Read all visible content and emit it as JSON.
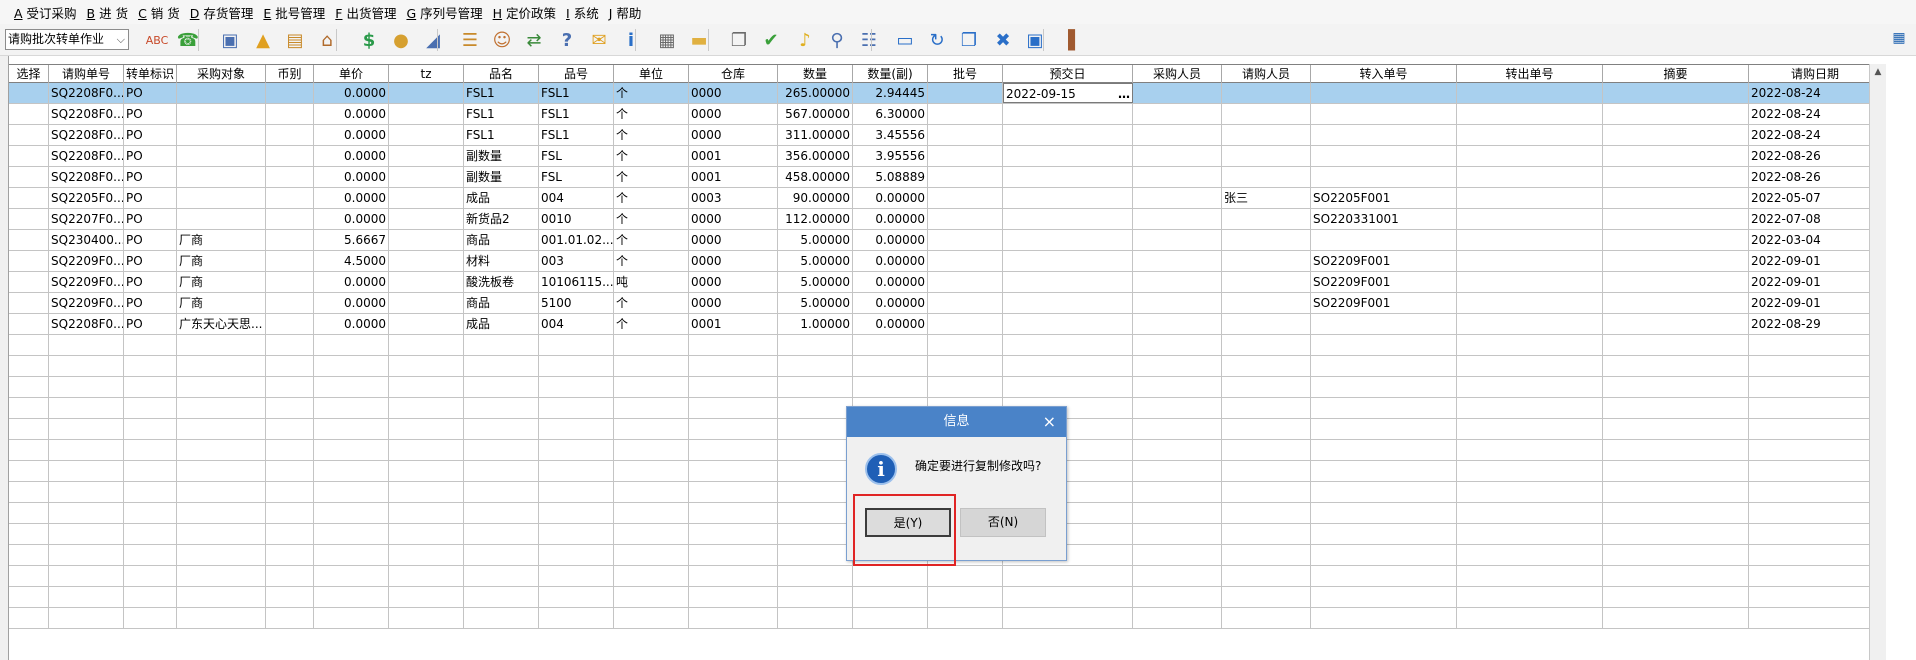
{
  "menu": [
    {
      "key": "A",
      "label": " 受订采购"
    },
    {
      "key": "B",
      "label": " 进 货"
    },
    {
      "key": "C",
      "label": " 销 货"
    },
    {
      "key": "D",
      "label": " 存货管理"
    },
    {
      "key": "E",
      "label": " 批号管理"
    },
    {
      "key": "F",
      "label": " 出货管理"
    },
    {
      "key": "G",
      "label": " 序列号管理"
    },
    {
      "key": "H",
      "label": " 定价政策"
    },
    {
      "key": "I",
      "label": " 系统"
    },
    {
      "key": "J",
      "label": " 帮助"
    }
  ],
  "toolbar": {
    "operation_select": "请购批次转单作业",
    "icons": [
      "spellcheck-icon",
      "phone-icon",
      "computer-icon",
      "lock-icon",
      "briefcase-icon",
      "home-icon",
      "dollar-icon",
      "money-bag-icon",
      "cart-icon",
      "clipboard-icon",
      "people-icon",
      "link-icon",
      "help-doc-icon",
      "mail-icon",
      "info-icon",
      "calculator-icon",
      "folder-icon",
      "copy-icon",
      "check-icon",
      "bell-icon",
      "search-icon",
      "org-chart-icon",
      "monitor-icon",
      "refresh-icon",
      "windows-icon",
      "close-icon",
      "window-icon",
      "exit-door-icon"
    ]
  },
  "grid": {
    "columns": [
      "选择",
      "请购单号",
      "转单标识",
      "采购对象",
      "币别",
      "单价",
      "tz",
      "品名",
      "品号",
      "单位",
      "仓库",
      "数量",
      "数量(副)",
      "批号",
      "预交日",
      "采购人员",
      "请购人员",
      "转入单号",
      "转出单号",
      "摘要",
      "请购日期"
    ],
    "rows": [
      [
        "",
        "SQ2208F0...",
        "PO",
        "",
        "",
        "0.0000",
        "",
        "FSL1",
        "FSL1",
        "个",
        "0000",
        "265.00000",
        "2.94445",
        "",
        "2022-09-15",
        "",
        "",
        "",
        "",
        "",
        "2022-08-24"
      ],
      [
        "",
        "SQ2208F0...",
        "PO",
        "",
        "",
        "0.0000",
        "",
        "FSL1",
        "FSL1",
        "个",
        "0000",
        "567.00000",
        "6.30000",
        "",
        "",
        "",
        "",
        "",
        "",
        "",
        "2022-08-24"
      ],
      [
        "",
        "SQ2208F0...",
        "PO",
        "",
        "",
        "0.0000",
        "",
        "FSL1",
        "FSL1",
        "个",
        "0000",
        "311.00000",
        "3.45556",
        "",
        "",
        "",
        "",
        "",
        "",
        "",
        "2022-08-24"
      ],
      [
        "",
        "SQ2208F0...",
        "PO",
        "",
        "",
        "0.0000",
        "",
        "副数量",
        "FSL",
        "个",
        "0001",
        "356.00000",
        "3.95556",
        "",
        "",
        "",
        "",
        "",
        "",
        "",
        "2022-08-26"
      ],
      [
        "",
        "SQ2208F0...",
        "PO",
        "",
        "",
        "0.0000",
        "",
        "副数量",
        "FSL",
        "个",
        "0001",
        "458.00000",
        "5.08889",
        "",
        "",
        "",
        "",
        "",
        "",
        "",
        "2022-08-26"
      ],
      [
        "",
        "SQ2205F0...",
        "PO",
        "",
        "",
        "0.0000",
        "",
        "成品",
        "004",
        "个",
        "0003",
        "90.00000",
        "0.00000",
        "",
        "",
        "",
        "张三",
        "SO2205F001",
        "",
        "",
        "2022-05-07"
      ],
      [
        "",
        "SQ2207F0...",
        "PO",
        "",
        "",
        "0.0000",
        "",
        "新货品2",
        "0010",
        "个",
        "0000",
        "112.00000",
        "0.00000",
        "",
        "",
        "",
        "",
        "SO220331001",
        "",
        "",
        "2022-07-08"
      ],
      [
        "",
        "SQ230400...",
        "PO",
        "厂商",
        "",
        "5.6667",
        "",
        "商品",
        "001.01.02...",
        "个",
        "0000",
        "5.00000",
        "0.00000",
        "",
        "",
        "",
        "",
        "",
        "",
        "",
        "2022-03-04"
      ],
      [
        "",
        "SQ2209F0...",
        "PO",
        "厂商",
        "",
        "4.5000",
        "",
        "材料",
        "003",
        "个",
        "0000",
        "5.00000",
        "0.00000",
        "",
        "",
        "",
        "",
        "SO2209F001",
        "",
        "",
        "2022-09-01"
      ],
      [
        "",
        "SQ2209F0...",
        "PO",
        "厂商",
        "",
        "0.0000",
        "",
        "酸洗板卷",
        "10106115...",
        "吨",
        "0000",
        "5.00000",
        "0.00000",
        "",
        "",
        "",
        "",
        "SO2209F001",
        "",
        "",
        "2022-09-01"
      ],
      [
        "",
        "SQ2209F0...",
        "PO",
        "厂商",
        "",
        "0.0000",
        "",
        "商品",
        "5100",
        "个",
        "0000",
        "5.00000",
        "0.00000",
        "",
        "",
        "",
        "",
        "SO2209F001",
        "",
        "",
        "2022-09-01"
      ],
      [
        "",
        "SQ2208F0...",
        "PO",
        "广东天心天思...",
        "",
        "0.0000",
        "",
        "成品",
        "004",
        "个",
        "0001",
        "1.00000",
        "0.00000",
        "",
        "",
        "",
        "",
        "",
        "",
        "",
        "2022-08-29"
      ]
    ],
    "selected_row": 0,
    "editing_cell": {
      "row": 0,
      "col": 14
    },
    "empty_rows": 14
  },
  "dialog": {
    "title": "信息",
    "close_glyph": "×",
    "icon": "info-icon",
    "message": "确定要进行复制修改吗?",
    "yes_label": "是(Y)",
    "no_label": "否(N)"
  },
  "colors": {
    "selected_row": "#a8d0ee",
    "dialog_title_bg": "#4a83c8",
    "highlight_border": "#e02424"
  }
}
